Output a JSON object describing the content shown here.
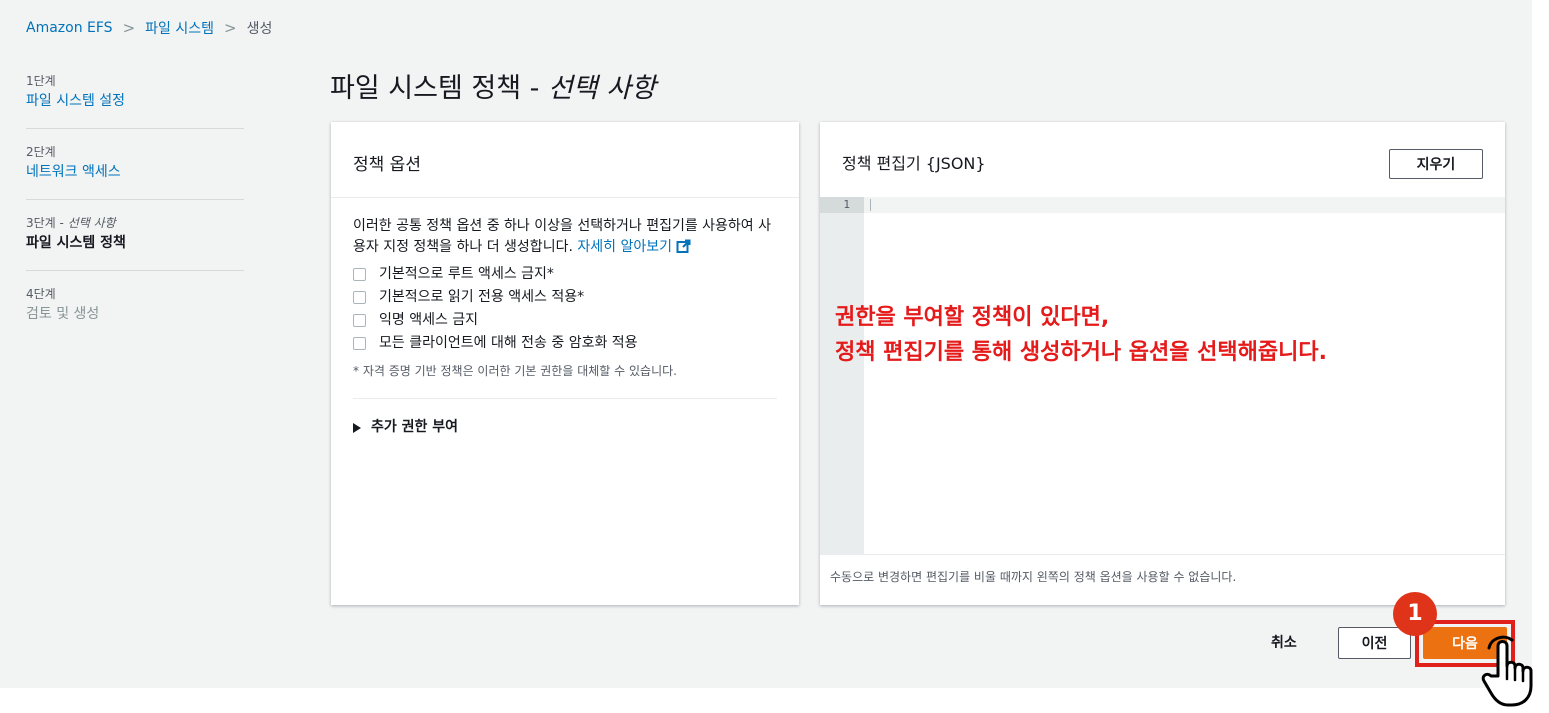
{
  "breadcrumb": {
    "root": "Amazon EFS",
    "section": "파일 시스템",
    "current": "생성"
  },
  "steps": [
    {
      "num": "1단계",
      "title": "파일 시스템 설정"
    },
    {
      "num": "2단계",
      "title": "네트워크 액세스"
    },
    {
      "num": "3단계 - ",
      "num_optional": "선택 사항",
      "title": "파일 시스템 정책"
    },
    {
      "num": "4단계",
      "title": "검토 및 생성"
    }
  ],
  "page": {
    "title": "파일 시스템 정책 - ",
    "title_optional": "선택 사항"
  },
  "policy_options": {
    "header": "정책 옵션",
    "description": "이러한 공통 정책 옵션 중 하나 이상을 선택하거나 편집기를 사용하여 사용자 지정 정책을 하나 더 생성합니다. ",
    "learn_more": "자세히 알아보기",
    "options": [
      "기본적으로 루트 액세스 금지*",
      "기본적으로 읽기 전용 액세스 적용*",
      "익명 액세스 금지",
      "모든 클라이언트에 대해 전송 중 암호화 적용"
    ],
    "footnote": "* 자격 증명 기반 정책은 이러한 기본 권한을 대체할 수 있습니다.",
    "expander": "추가 권한 부여"
  },
  "editor": {
    "header": "정책 편집기 {JSON}",
    "clear_label": "지우기",
    "line_number": "1",
    "footer": "수동으로 변경하면 편집기를 비울 때까지 왼쪽의 정책 옵션을 사용할 수 없습니다."
  },
  "annotation": {
    "line1": "권한을 부여할 정책이 있다면,",
    "line2": "정책 편집기를 통해 생성하거나 옵션을 선택해줍니다."
  },
  "actions": {
    "cancel": "취소",
    "previous": "이전",
    "next": "다음",
    "step_badge": "1"
  },
  "colors": {
    "primary": "#ec7211",
    "link": "#0073bb",
    "annotation": "#e51a1a"
  }
}
